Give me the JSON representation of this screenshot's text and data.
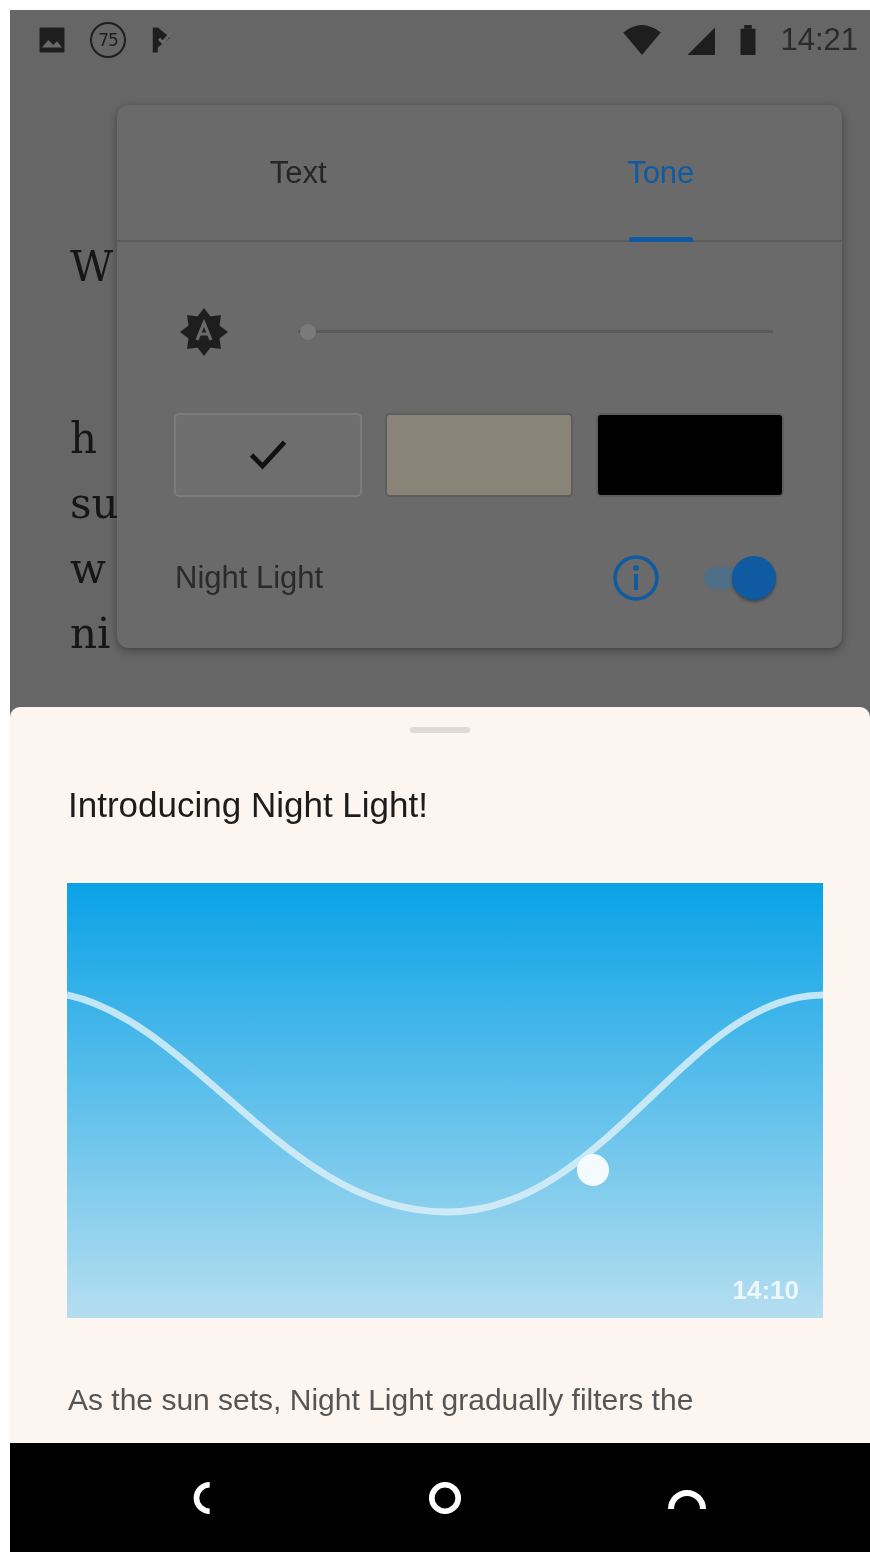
{
  "status_bar": {
    "badge": "75",
    "time": "14:21"
  },
  "book_paragraphs": [
    [
      "W"
    ],
    [
      "h",
      "su",
      "w",
      "ni"
    ]
  ],
  "panel": {
    "tabs": [
      {
        "label": "Text",
        "selected": false
      },
      {
        "label": "Tone",
        "selected": true
      }
    ],
    "brightness": {
      "level": 0.02
    },
    "themes": [
      {
        "color": "#6e6e6e",
        "selected": true
      },
      {
        "color": "#8a8478",
        "selected": false
      },
      {
        "color": "#000000",
        "selected": false
      }
    ],
    "night_light": {
      "label": "Night Light",
      "on": true
    }
  },
  "sheet": {
    "title": "Introducing Night Light!",
    "illustration_time": "14:10",
    "body": "As the sun sets, Night Light gradually filters the"
  }
}
